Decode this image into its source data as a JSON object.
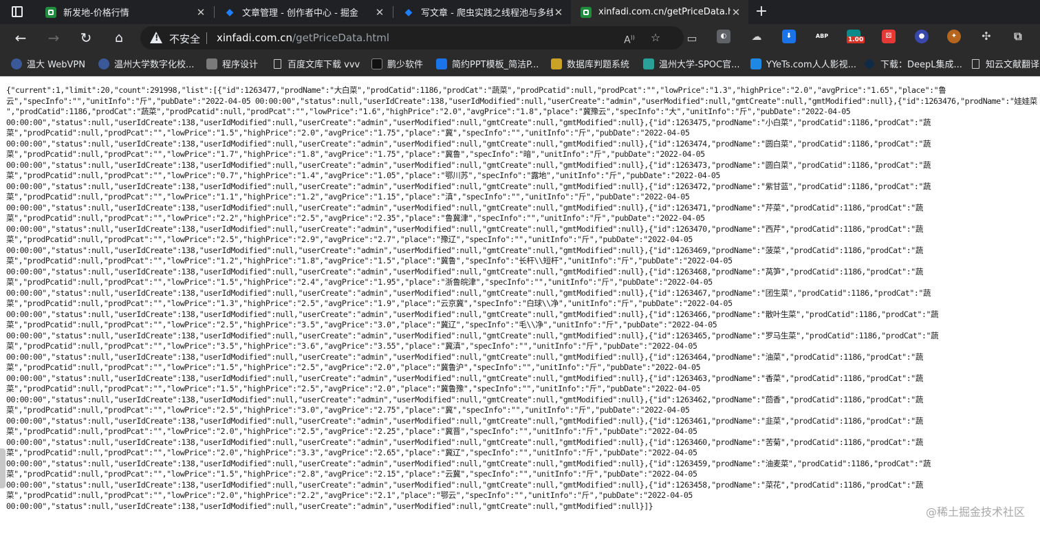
{
  "tabs": [
    {
      "title": "新发地-价格行情",
      "favicon_color": "#1e8e3e"
    },
    {
      "title": "文章管理 - 创作者中心 - 掘金",
      "favicon_color": "#1e80ff"
    },
    {
      "title": "写文章 - 爬虫实践之线程池与多线",
      "favicon_color": "#1e80ff"
    },
    {
      "title": "xinfadi.com.cn/getPriceData.htm",
      "favicon_color": "#1e8e3e"
    }
  ],
  "address_bar": {
    "security_label": "不安全",
    "url_host": "xinfadi.com.cn",
    "url_path": "/getPriceData.html"
  },
  "extensions": [
    {
      "name": "abp-icon",
      "label": "ABP",
      "color": "#d0021b"
    },
    {
      "name": "badge-icon",
      "label": "1.00",
      "color": "#d93025"
    }
  ],
  "bookmarks": [
    {
      "name": "bookmark-wzu-webvpn",
      "label": "温大 WebVPN",
      "color": "#3b5998"
    },
    {
      "name": "bookmark-wzu-digital",
      "label": "温州大学数字化校...",
      "color": "#3b5998"
    },
    {
      "name": "bookmark-programming",
      "label": "程序设计",
      "color": "#7a7a7a"
    },
    {
      "name": "bookmark-baidu-wenku",
      "label": "百度文库下载 vvv",
      "color": "page"
    },
    {
      "name": "bookmark-pengshao",
      "label": "鹏少软件",
      "color": "#111111"
    },
    {
      "name": "bookmark-ppt",
      "label": "简约PPT模板_简洁P...",
      "color": "#1a73e8"
    },
    {
      "name": "bookmark-db-judge",
      "label": "数据库判题系统",
      "color": "#c9a227"
    },
    {
      "name": "bookmark-wzu-spoc",
      "label": "温州大学-SPOC官...",
      "color": "#2aa198"
    },
    {
      "name": "bookmark-yyets",
      "label": "YYeTs.com人人影视...",
      "color": "#1e88e5"
    },
    {
      "name": "bookmark-deepl",
      "label": "下载：DeepL集成...",
      "color": "#0f2b46"
    },
    {
      "name": "bookmark-zhiyun",
      "label": "知云文献翻译",
      "color": "page"
    }
  ],
  "json_text": "{\"current\":1,\"limit\":20,\"count\":291998,\"list\":[{\"id\":1263477,\"prodName\":\"大白菜\",\"prodCatid\":1186,\"prodCat\":\"蔬菜\",\"prodPcatid\":null,\"prodPcat\":\"\",\"lowPrice\":\"1.3\",\"highPrice\":\"2.0\",\"avgPrice\":\"1.65\",\"place\":\"鲁\n云\",\"specInfo\":\"\",\"unitInfo\":\"斤\",\"pubDate\":\"2022-04-05 00:00:00\",\"status\":null,\"userIdCreate\":138,\"userIdModified\":null,\"userCreate\":\"admin\",\"userModified\":null,\"gmtCreate\":null,\"gmtModified\":null},{\"id\":1263476,\"prodName\":\"娃娃菜\n\",\"prodCatid\":1186,\"prodCat\":\"蔬菜\",\"prodPcatid\":null,\"prodPcat\":\"\",\"lowPrice\":\"1.6\",\"highPrice\":\"2.0\",\"avgPrice\":\"1.8\",\"place\":\"冀豫云\",\"specInfo\":\"大\",\"unitInfo\":\"斤\",\"pubDate\":\"2022-04-05\n00:00:00\",\"status\":null,\"userIdCreate\":138,\"userIdModified\":null,\"userCreate\":\"admin\",\"userModified\":null,\"gmtCreate\":null,\"gmtModified\":null},{\"id\":1263475,\"prodName\":\"小白菜\",\"prodCatid\":1186,\"prodCat\":\"蔬\n菜\",\"prodPcatid\":null,\"prodPcat\":\"\",\"lowPrice\":\"1.5\",\"highPrice\":\"2.0\",\"avgPrice\":\"1.75\",\"place\":\"冀\",\"specInfo\":\"\",\"unitInfo\":\"斤\",\"pubDate\":\"2022-04-05\n00:00:00\",\"status\":null,\"userIdCreate\":138,\"userIdModified\":null,\"userCreate\":\"admin\",\"userModified\":null,\"gmtCreate\":null,\"gmtModified\":null},{\"id\":1263474,\"prodName\":\"圆白菜\",\"prodCatid\":1186,\"prodCat\":\"蔬\n菜\",\"prodPcatid\":null,\"prodPcat\":\"\",\"lowPrice\":\"1.7\",\"highPrice\":\"1.8\",\"avgPrice\":\"1.75\",\"place\":\"冀鲁\",\"specInfo\":\"暗\",\"unitInfo\":\"斤\",\"pubDate\":\"2022-04-05\n00:00:00\",\"status\":null,\"userIdCreate\":138,\"userIdModified\":null,\"userCreate\":\"admin\",\"userModified\":null,\"gmtCreate\":null,\"gmtModified\":null},{\"id\":1263473,\"prodName\":\"圆白菜\",\"prodCatid\":1186,\"prodCat\":\"蔬\n菜\",\"prodPcatid\":null,\"prodPcat\":\"\",\"lowPrice\":\"0.7\",\"highPrice\":\"1.4\",\"avgPrice\":\"1.05\",\"place\":\"鄂川苏\",\"specInfo\":\"露地\",\"unitInfo\":\"斤\",\"pubDate\":\"2022-04-05\n00:00:00\",\"status\":null,\"userIdCreate\":138,\"userIdModified\":null,\"userCreate\":\"admin\",\"userModified\":null,\"gmtCreate\":null,\"gmtModified\":null},{\"id\":1263472,\"prodName\":\"紫甘蓝\",\"prodCatid\":1186,\"prodCat\":\"蔬\n菜\",\"prodPcatid\":null,\"prodPcat\":\"\",\"lowPrice\":\"1.1\",\"highPrice\":\"1.2\",\"avgPrice\":\"1.15\",\"place\":\"滇\",\"specInfo\":\"\",\"unitInfo\":\"斤\",\"pubDate\":\"2022-04-05\n00:00:00\",\"status\":null,\"userIdCreate\":138,\"userIdModified\":null,\"userCreate\":\"admin\",\"userModified\":null,\"gmtCreate\":null,\"gmtModified\":null},{\"id\":1263471,\"prodName\":\"芹菜\",\"prodCatid\":1186,\"prodCat\":\"蔬\n菜\",\"prodPcatid\":null,\"prodPcat\":\"\",\"lowPrice\":\"2.2\",\"highPrice\":\"2.5\",\"avgPrice\":\"2.35\",\"place\":\"鲁冀津\",\"specInfo\":\"\",\"unitInfo\":\"斤\",\"pubDate\":\"2022-04-05\n00:00:00\",\"status\":null,\"userIdCreate\":138,\"userIdModified\":null,\"userCreate\":\"admin\",\"userModified\":null,\"gmtCreate\":null,\"gmtModified\":null},{\"id\":1263470,\"prodName\":\"西芹\",\"prodCatid\":1186,\"prodCat\":\"蔬\n菜\",\"prodPcatid\":null,\"prodPcat\":\"\",\"lowPrice\":\"2.5\",\"highPrice\":\"2.9\",\"avgPrice\":\"2.7\",\"place\":\"豫辽\",\"specInfo\":\"\",\"unitInfo\":\"斤\",\"pubDate\":\"2022-04-05\n00:00:00\",\"status\":null,\"userIdCreate\":138,\"userIdModified\":null,\"userCreate\":\"admin\",\"userModified\":null,\"gmtCreate\":null,\"gmtModified\":null},{\"id\":1263469,\"prodName\":\"菠菜\",\"prodCatid\":1186,\"prodCat\":\"蔬\n菜\",\"prodPcatid\":null,\"prodPcat\":\"\",\"lowPrice\":\"1.2\",\"highPrice\":\"1.8\",\"avgPrice\":\"1.5\",\"place\":\"冀鲁\",\"specInfo\":\"长杆\\\\短杆\",\"unitInfo\":\"斤\",\"pubDate\":\"2022-04-05\n00:00:00\",\"status\":null,\"userIdCreate\":138,\"userIdModified\":null,\"userCreate\":\"admin\",\"userModified\":null,\"gmtCreate\":null,\"gmtModified\":null},{\"id\":1263468,\"prodName\":\"莴笋\",\"prodCatid\":1186,\"prodCat\":\"蔬\n菜\",\"prodPcatid\":null,\"prodPcat\":\"\",\"lowPrice\":\"1.5\",\"highPrice\":\"2.4\",\"avgPrice\":\"1.95\",\"place\":\"浙鲁皖津\",\"specInfo\":\"\",\"unitInfo\":\"斤\",\"pubDate\":\"2022-04-05\n00:00:00\",\"status\":null,\"userIdCreate\":138,\"userIdModified\":null,\"userCreate\":\"admin\",\"userModified\":null,\"gmtCreate\":null,\"gmtModified\":null},{\"id\":1263467,\"prodName\":\"团生菜\",\"prodCatid\":1186,\"prodCat\":\"蔬\n菜\",\"prodPcatid\":null,\"prodPcat\":\"\",\"lowPrice\":\"1.3\",\"highPrice\":\"2.5\",\"avgPrice\":\"1.9\",\"place\":\"云京冀\",\"specInfo\":\"白球\\\\净\",\"unitInfo\":\"斤\",\"pubDate\":\"2022-04-05\n00:00:00\",\"status\":null,\"userIdCreate\":138,\"userIdModified\":null,\"userCreate\":\"admin\",\"userModified\":null,\"gmtCreate\":null,\"gmtModified\":null},{\"id\":1263466,\"prodName\":\"散叶生菜\",\"prodCatid\":1186,\"prodCat\":\"蔬\n菜\",\"prodPcatid\":null,\"prodPcat\":\"\",\"lowPrice\":\"2.5\",\"highPrice\":\"3.5\",\"avgPrice\":\"3.0\",\"place\":\"冀辽\",\"specInfo\":\"毛\\\\净\",\"unitInfo\":\"斤\",\"pubDate\":\"2022-04-05\n00:00:00\",\"status\":null,\"userIdCreate\":138,\"userIdModified\":null,\"userCreate\":\"admin\",\"userModified\":null,\"gmtCreate\":null,\"gmtModified\":null},{\"id\":1263465,\"prodName\":\"罗马生菜\",\"prodCatid\":1186,\"prodCat\":\"蔬\n菜\",\"prodPcatid\":null,\"prodPcat\":\"\",\"lowPrice\":\"3.5\",\"highPrice\":\"3.6\",\"avgPrice\":\"3.55\",\"place\":\"冀滇\",\"specInfo\":\"\",\"unitInfo\":\"斤\",\"pubDate\":\"2022-04-05\n00:00:00\",\"status\":null,\"userIdCreate\":138,\"userIdModified\":null,\"userCreate\":\"admin\",\"userModified\":null,\"gmtCreate\":null,\"gmtModified\":null},{\"id\":1263464,\"prodName\":\"油菜\",\"prodCatid\":1186,\"prodCat\":\"蔬\n菜\",\"prodPcatid\":null,\"prodPcat\":\"\",\"lowPrice\":\"1.5\",\"highPrice\":\"2.5\",\"avgPrice\":\"2.0\",\"place\":\"冀鲁沪\",\"specInfo\":\"\",\"unitInfo\":\"斤\",\"pubDate\":\"2022-04-05\n00:00:00\",\"status\":null,\"userIdCreate\":138,\"userIdModified\":null,\"userCreate\":\"admin\",\"userModified\":null,\"gmtCreate\":null,\"gmtModified\":null},{\"id\":1263463,\"prodName\":\"香菜\",\"prodCatid\":1186,\"prodCat\":\"蔬\n菜\",\"prodPcatid\":null,\"prodPcat\":\"\",\"lowPrice\":\"1.5\",\"highPrice\":\"2.5\",\"avgPrice\":\"2.0\",\"place\":\"冀鲁豫\",\"specInfo\":\"\",\"unitInfo\":\"斤\",\"pubDate\":\"2022-04-05\n00:00:00\",\"status\":null,\"userIdCreate\":138,\"userIdModified\":null,\"userCreate\":\"admin\",\"userModified\":null,\"gmtCreate\":null,\"gmtModified\":null},{\"id\":1263462,\"prodName\":\"茴香\",\"prodCatid\":1186,\"prodCat\":\"蔬\n菜\",\"prodPcatid\":null,\"prodPcat\":\"\",\"lowPrice\":\"2.5\",\"highPrice\":\"3.0\",\"avgPrice\":\"2.75\",\"place\":\"冀\",\"specInfo\":\"\",\"unitInfo\":\"斤\",\"pubDate\":\"2022-04-05\n00:00:00\",\"status\":null,\"userIdCreate\":138,\"userIdModified\":null,\"userCreate\":\"admin\",\"userModified\":null,\"gmtCreate\":null,\"gmtModified\":null},{\"id\":1263461,\"prodName\":\"韭菜\",\"prodCatid\":1186,\"prodCat\":\"蔬\n菜\",\"prodPcatid\":null,\"prodPcat\":\"\",\"lowPrice\":\"2.0\",\"highPrice\":\"2.5\",\"avgPrice\":\"2.25\",\"place\":\"冀晋\",\"specInfo\":\"\",\"unitInfo\":\"斤\",\"pubDate\":\"2022-04-05\n00:00:00\",\"status\":null,\"userIdCreate\":138,\"userIdModified\":null,\"userCreate\":\"admin\",\"userModified\":null,\"gmtCreate\":null,\"gmtModified\":null},{\"id\":1263460,\"prodName\":\"苦菊\",\"prodCatid\":1186,\"prodCat\":\"蔬\n菜\",\"prodPcatid\":null,\"prodPcat\":\"\",\"lowPrice\":\"2.0\",\"highPrice\":\"3.3\",\"avgPrice\":\"2.65\",\"place\":\"冀辽\",\"specInfo\":\"\",\"unitInfo\":\"斤\",\"pubDate\":\"2022-04-05\n00:00:00\",\"status\":null,\"userIdCreate\":138,\"userIdModified\":null,\"userCreate\":\"admin\",\"userModified\":null,\"gmtCreate\":null,\"gmtModified\":null},{\"id\":1263459,\"prodName\":\"油麦菜\",\"prodCatid\":1186,\"prodCat\":\"蔬\n菜\",\"prodPcatid\":null,\"prodPcat\":\"\",\"lowPrice\":\"1.5\",\"highPrice\":\"2.8\",\"avgPrice\":\"2.15\",\"place\":\"云冀\",\"specInfo\":\"\",\"unitInfo\":\"斤\",\"pubDate\":\"2022-04-05\n00:00:00\",\"status\":null,\"userIdCreate\":138,\"userIdModified\":null,\"userCreate\":\"admin\",\"userModified\":null,\"gmtCreate\":null,\"gmtModified\":null},{\"id\":1263458,\"prodName\":\"菜花\",\"prodCatid\":1186,\"prodCat\":\"蔬\n菜\",\"prodPcatid\":null,\"prodPcat\":\"\",\"lowPrice\":\"2.0\",\"highPrice\":\"2.2\",\"avgPrice\":\"2.1\",\"place\":\"鄂云\",\"specInfo\":\"\",\"unitInfo\":\"斤\",\"pubDate\":\"2022-04-05\n00:00:00\",\"status\":null,\"userIdCreate\":138,\"userIdModified\":null,\"userCreate\":\"admin\",\"userModified\":null,\"gmtCreate\":null,\"gmtModified\":null}]}",
  "watermark": "@稀土掘金技术社区"
}
